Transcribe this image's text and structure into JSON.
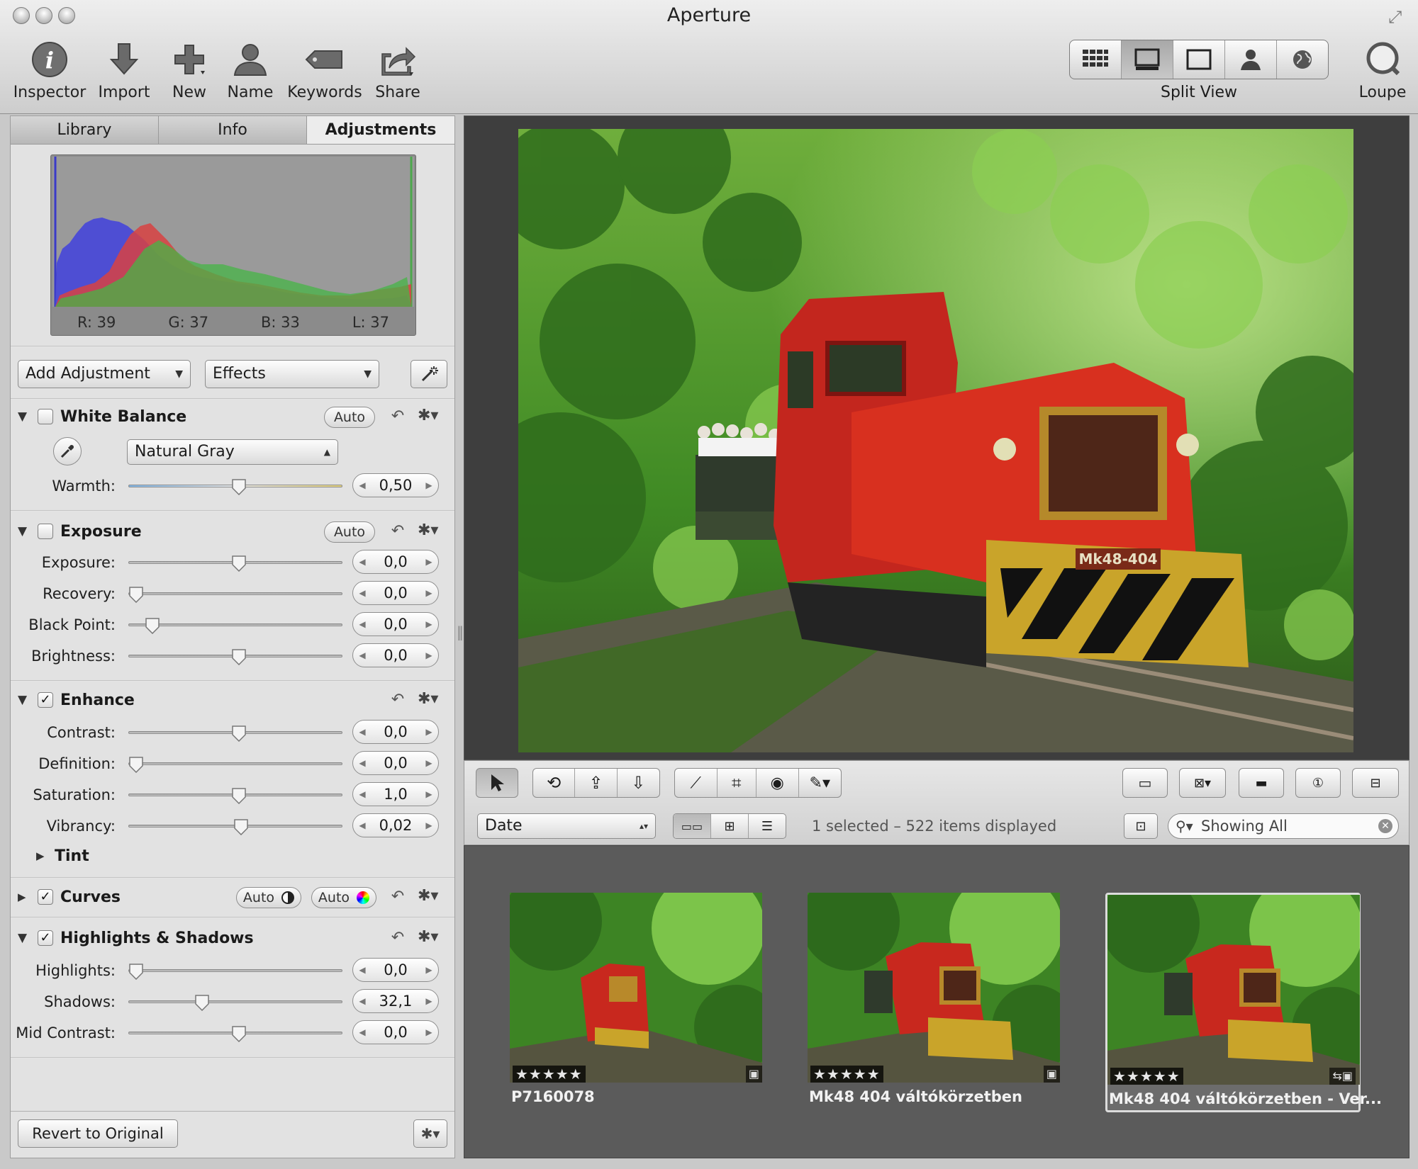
{
  "window": {
    "title": "Aperture"
  },
  "toolbar": {
    "inspector": "Inspector",
    "import": "Import",
    "new": "New",
    "name": "Name",
    "keywords": "Keywords",
    "share": "Share",
    "split_view": "Split View",
    "loupe": "Loupe"
  },
  "inspector": {
    "tabs": [
      "Library",
      "Info",
      "Adjustments"
    ],
    "active_tab": "Adjustments",
    "histogram": {
      "r": "R: 39",
      "g": "G: 37",
      "b": "B: 33",
      "l": "L: 37"
    },
    "add_adjustment": "Add Adjustment",
    "effects": "Effects",
    "white_balance": {
      "title": "White Balance",
      "auto": "Auto",
      "mode": "Natural Gray",
      "warmth_label": "Warmth:",
      "warmth_value": "0,50",
      "warmth_level": 0.5
    },
    "exposure": {
      "title": "Exposure",
      "auto": "Auto",
      "rows": [
        {
          "label": "Exposure:",
          "value": "0,0",
          "level": 0.5
        },
        {
          "label": "Recovery:",
          "value": "0,0",
          "level": 0.0
        },
        {
          "label": "Black Point:",
          "value": "0,0",
          "level": 0.08
        },
        {
          "label": "Brightness:",
          "value": "0,0",
          "level": 0.5
        }
      ]
    },
    "enhance": {
      "title": "Enhance",
      "rows": [
        {
          "label": "Contrast:",
          "value": "0,0",
          "level": 0.5
        },
        {
          "label": "Definition:",
          "value": "0,0",
          "level": 0.0
        },
        {
          "label": "Saturation:",
          "value": "1,0",
          "level": 0.5
        },
        {
          "label": "Vibrancy:",
          "value": "0,02",
          "level": 0.51
        }
      ],
      "tint": "Tint"
    },
    "curves": {
      "title": "Curves",
      "auto1": "Auto",
      "auto2": "Auto"
    },
    "highlights_shadows": {
      "title": "Highlights & Shadows",
      "rows": [
        {
          "label": "Highlights:",
          "value": "0,0",
          "level": 0.0
        },
        {
          "label": "Shadows:",
          "value": "32,1",
          "level": 0.32
        },
        {
          "label": "Mid Contrast:",
          "value": "0,0",
          "level": 0.5
        }
      ]
    },
    "revert": "Revert to Original"
  },
  "browser_bar": {
    "sort": "Date",
    "status": "1 selected – 522 items displayed",
    "search": "Showing All"
  },
  "thumbnails": [
    {
      "name": "P7160078",
      "stars": "★★★★★"
    },
    {
      "name": "Mk48 404 váltókörzetben",
      "stars": "★★★★★"
    },
    {
      "name": "Mk48 404 váltókörzetben - Ver...",
      "stars": "★★★★★"
    }
  ],
  "photo": {
    "locomotive_plate": "Mk48-404"
  }
}
